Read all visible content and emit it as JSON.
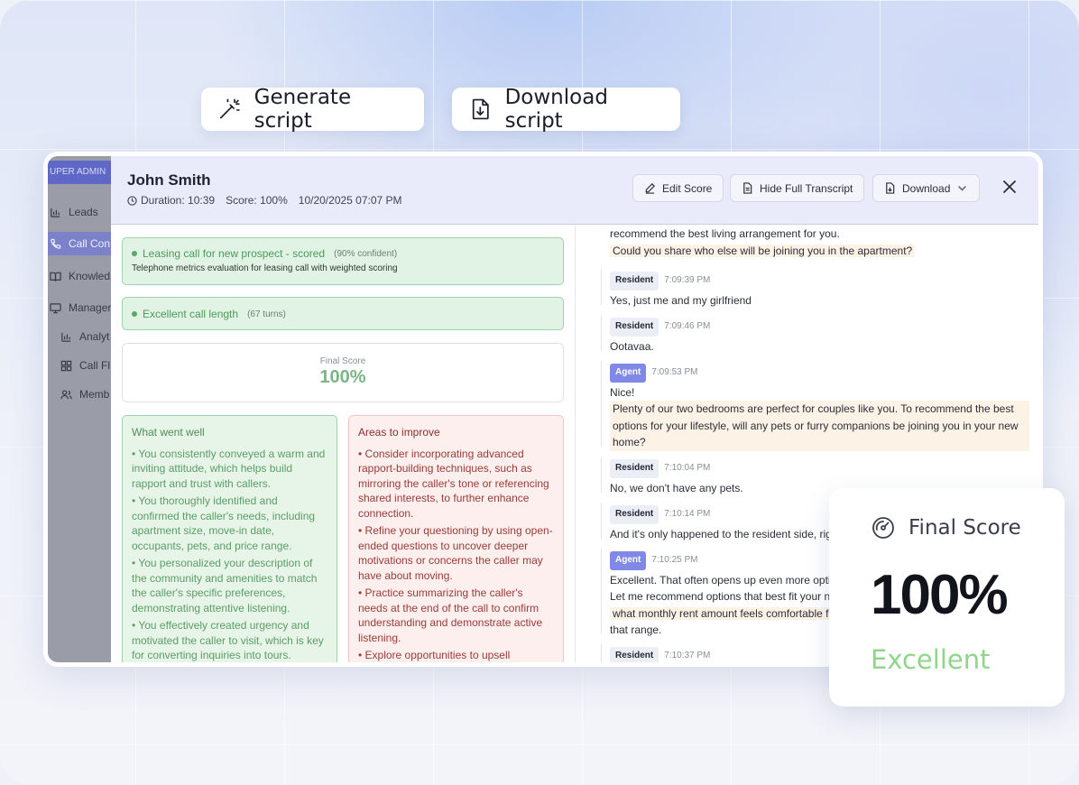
{
  "top_actions": {
    "generate_label": "Generate script",
    "download_label": "Download script"
  },
  "sidebar": {
    "admin_label": "UPER ADMIN",
    "items": [
      {
        "label": "Leads",
        "icon": "bar-chart-icon"
      },
      {
        "label": "Call Con",
        "icon": "phone-icon"
      },
      {
        "label": "Knowled",
        "icon": "book-icon"
      },
      {
        "label": "Manager",
        "icon": "monitor-icon"
      },
      {
        "label": "Analyt",
        "icon": "chart-icon"
      },
      {
        "label": "Call Fl",
        "icon": "grid-icon"
      },
      {
        "label": "Memb",
        "icon": "users-icon"
      }
    ]
  },
  "header": {
    "name": "John Smith",
    "duration": "Duration: 10:39",
    "score": "Score: 100%",
    "datetime": "10/20/2025 07:07 PM",
    "edit_score_label": "Edit Score",
    "hide_transcript_label": "Hide Full Transcript",
    "download_label": "Download"
  },
  "summary": {
    "call_type": "Leasing call for new prospect - scored",
    "call_type_confidence": "(90% confident)",
    "call_type_desc": "Telephone metrics evaluation for leasing call with weighted scoring",
    "call_length": "Excellent call length",
    "call_length_turns": "(67 turns)",
    "final_label": "Final Score",
    "final_value": "100%"
  },
  "well": {
    "title": "What went well",
    "items": [
      "• You consistently conveyed a warm and inviting attitude, which helps build rapport and trust with callers.",
      "• You thoroughly identified and confirmed the caller's needs, including apartment size, move-in date, occupants, pets, and price range.",
      "• You personalized your description of the community and amenities to match the caller's specific preferences, demonstrating attentive listening.",
      "• You effectively created urgency and motivated the caller to visit, which is key for converting inquiries into tours."
    ]
  },
  "improve": {
    "title": "Areas to improve",
    "items": [
      "• Consider incorporating advanced rapport-building techniques, such as mirroring the caller's tone or referencing shared interests, to further enhance connection.",
      "• Refine your questioning by using open-ended questions to uncover deeper motivations or concerns the caller may have about moving.",
      "• Practice summarizing the caller's needs at the end of the call to confirm understanding and demonstrate active listening.",
      "• Explore opportunities to upsell premium features or amenities based on"
    ]
  },
  "transcript": {
    "top_text": "recommend the best living arrangement for you.",
    "top_question": "Could you share who else will be joining you in the apartment?",
    "messages": [
      {
        "role": "Resident",
        "time": "7:09:39 PM",
        "text": "Yes, just me and my girlfriend"
      },
      {
        "role": "Resident",
        "time": "7:09:46 PM",
        "text": "Ootavaa."
      },
      {
        "role": "Agent",
        "time": "7:09:53 PM",
        "text": "Nice!",
        "highlight": "Plenty of our two bedrooms are perfect for couples like you. To recommend the best options for your lifestyle, will any pets or furry companions be joining you in your new home?"
      },
      {
        "role": "Resident",
        "time": "7:10:04 PM",
        "text": "No, we don't have any pets."
      },
      {
        "role": "Resident",
        "time": "7:10:14 PM",
        "text": "And it's only happened to the resident side, rig"
      },
      {
        "role": "Agent",
        "time": "7:10:25 PM",
        "text": "Excellent. That often opens up even more optio",
        "text2": "Let me recommend options that best fit your n",
        "highlight": "what monthly rent amount feels comfortable f",
        "text3": "that range."
      },
      {
        "role": "Resident",
        "time": "7:10:37 PM",
        "text": ""
      }
    ]
  },
  "score_card": {
    "label": "Final Score",
    "value": "100%",
    "rating": "Excellent",
    "rating_color": "#8fd68a"
  }
}
